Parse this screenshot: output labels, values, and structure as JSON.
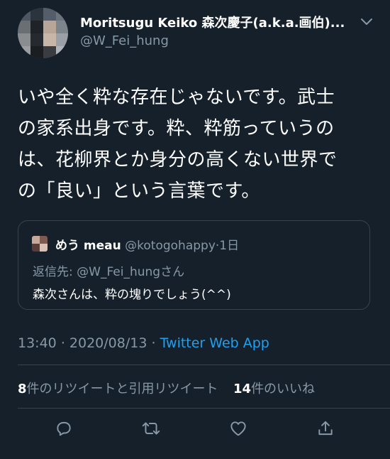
{
  "author": {
    "display_name": "Moritsugu Keiko 森次慶子(a.k.a.画伯)...",
    "handle": "@W_Fei_hung"
  },
  "tweet": {
    "text_lines": [
      "いや全く粋な存在じゃないです。武士",
      "の家系出身です。粋、粋筋っていうの",
      "は、花柳界とか身分の高くない世界で",
      "の「良い」という言葉です。"
    ]
  },
  "quoted": {
    "name": "めう meau",
    "handle": "@kotogohappy",
    "separator": "·",
    "time": "1日",
    "reply_to": "返信先: @W_Fei_hungさん",
    "text": "森次さんは、粋の塊りでしょう(^^)"
  },
  "meta": {
    "time": "13:40",
    "separator": "·",
    "date": "2020/08/13",
    "source": "Twitter Web App"
  },
  "stats": {
    "retweet_count": "8",
    "retweet_label": "件のリツイートと引用リツイート",
    "like_count": "14",
    "like_label": "件のいいね"
  },
  "icons": {
    "more": "chevron-down-icon",
    "reply": "reply-icon",
    "retweet": "retweet-icon",
    "like": "heart-icon",
    "share": "share-icon"
  },
  "colors": {
    "background": "#15202b",
    "primary_text": "#ffffff",
    "secondary_text": "#8899a6",
    "accent": "#1da1f2",
    "border": "#38444d"
  }
}
